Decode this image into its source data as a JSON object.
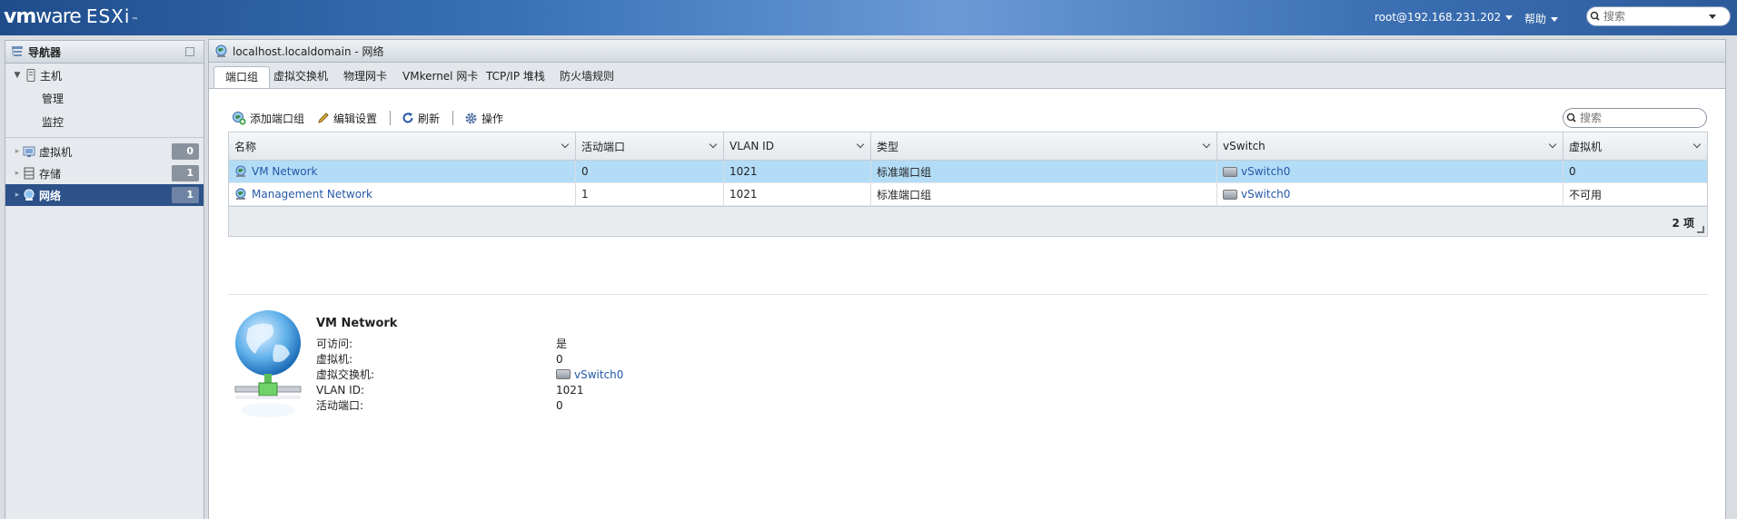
{
  "header": {
    "brand_vm": "vm",
    "brand_ware": "ware",
    "brand_product": "ESXi",
    "brand_tm": "™",
    "user": "root@192.168.231.202",
    "help": "帮助",
    "search_placeholder": "搜索"
  },
  "navigator": {
    "title": "导航器",
    "host": {
      "label": "主机",
      "children": [
        "管理",
        "监控"
      ]
    },
    "items": [
      {
        "label": "虚拟机",
        "count": "0"
      },
      {
        "label": "存储",
        "count": "1"
      },
      {
        "label": "网络",
        "count": "1"
      }
    ]
  },
  "main": {
    "title": "localhost.localdomain - 网络",
    "tabs": [
      "端口组",
      "虚拟交换机",
      "物理网卡",
      "VMkernel 网卡",
      "TCP/IP 堆栈",
      "防火墙规则"
    ],
    "active_tab": 0,
    "toolbar": {
      "add": "添加端口组",
      "edit": "编辑设置",
      "refresh": "刷新",
      "actions": "操作"
    },
    "search_placeholder": "搜索",
    "table": {
      "columns": [
        "名称",
        "活动端口",
        "VLAN ID",
        "类型",
        "vSwitch",
        "虚拟机"
      ],
      "rows": [
        [
          "VM Network",
          "0",
          "1021",
          "标准端口组",
          "vSwitch0",
          "0"
        ],
        [
          "Management Network",
          "1",
          "1021",
          "标准端口组",
          "vSwitch0",
          "不可用"
        ]
      ],
      "footer": "2 项"
    },
    "detail": {
      "title": "VM Network",
      "properties": [
        {
          "label": "可访问:",
          "value": "是"
        },
        {
          "label": "虚拟机:",
          "value": "0"
        },
        {
          "label": "虚拟交换机:",
          "value": "vSwitch0"
        },
        {
          "label": "VLAN ID:",
          "value": "1021"
        },
        {
          "label": "活动端口:",
          "value": "0"
        }
      ]
    }
  },
  "colors": {
    "nav_selected": "#2d5289",
    "row_selected": "#b3dcf7",
    "link": "#2558a8"
  }
}
